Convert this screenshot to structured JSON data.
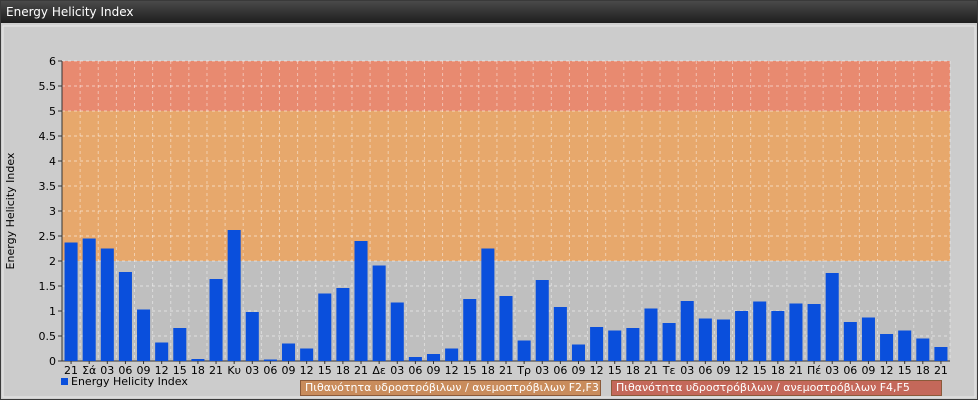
{
  "window": {
    "title": "Energy Helicity Index"
  },
  "colors": {
    "bar": "#0a4fdc",
    "zone_low": "#bfbfbf",
    "zone_mid": "#e7a86c",
    "zone_high": "#e88a70"
  },
  "legend": {
    "series_label": "Energy Helicity Index",
    "zone_mid_label": "Πιθανότητα υδροστρόβιλων / ανεμοστρόβιλων F2,F3",
    "zone_high_label": "Πιθανότητα υδροστρόβιλων / ανεμοστρόβιλων F4,F5"
  },
  "chart_data": {
    "type": "bar",
    "title": "",
    "xlabel": "",
    "ylabel": "Energy Helicity Index",
    "ylim": [
      0,
      6
    ],
    "yticks": [
      "0",
      "0.5",
      "1",
      "1.5",
      "2",
      "2.5",
      "3",
      "3.5",
      "4",
      "4.5",
      "5",
      "5.5",
      "6"
    ],
    "grid": true,
    "legend_position": "bottom-left",
    "zones": [
      {
        "from": 0,
        "to": 2,
        "color": "#bfbfbf"
      },
      {
        "from": 2,
        "to": 5,
        "color": "#e7a86c"
      },
      {
        "from": 5,
        "to": 6,
        "color": "#e88a70"
      }
    ],
    "categories": [
      "21",
      "Σά",
      "03",
      "06",
      "09",
      "12",
      "15",
      "18",
      "21",
      "Κυ",
      "03",
      "06",
      "09",
      "12",
      "15",
      "18",
      "21",
      "Δε",
      "03",
      "06",
      "09",
      "12",
      "15",
      "18",
      "21",
      "Τρ",
      "03",
      "06",
      "09",
      "12",
      "15",
      "18",
      "21",
      "Τε",
      "03",
      "06",
      "09",
      "12",
      "15",
      "18",
      "21",
      "Πέ",
      "03",
      "06",
      "09",
      "12",
      "15",
      "18",
      "21"
    ],
    "series": [
      {
        "name": "Energy Helicity Index",
        "values": [
          2.37,
          2.45,
          2.25,
          1.78,
          1.03,
          0.37,
          0.66,
          0.04,
          1.64,
          2.62,
          0.98,
          0.03,
          0.35,
          0.25,
          1.35,
          1.46,
          2.4,
          1.91,
          1.17,
          0.08,
          0.14,
          0.25,
          1.24,
          2.25,
          1.3,
          0.41,
          1.62,
          1.08,
          0.33,
          0.68,
          0.61,
          0.66,
          1.05,
          0.76,
          1.2,
          0.85,
          0.83,
          1.0,
          1.19,
          1.0,
          1.15,
          1.14,
          1.76,
          0.78,
          0.87,
          0.54,
          0.61,
          0.45,
          0.28
        ]
      }
    ]
  }
}
